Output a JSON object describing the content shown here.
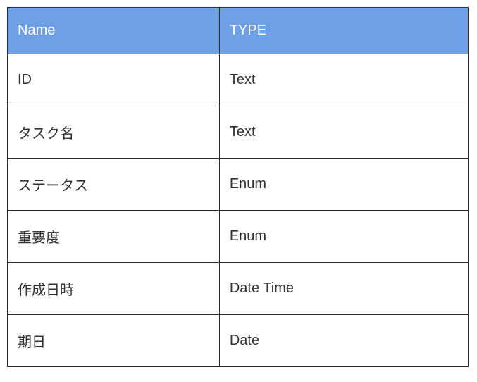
{
  "table": {
    "headers": {
      "name": "Name",
      "type": "TYPE"
    },
    "rows": [
      {
        "name": "ID",
        "type": "Text"
      },
      {
        "name": "タスク名",
        "type": "Text"
      },
      {
        "name": "ステータス",
        "type": "Enum"
      },
      {
        "name": "重要度",
        "type": "Enum"
      },
      {
        "name": "作成日時",
        "type": "Date Time"
      },
      {
        "name": "期日",
        "type": "Date"
      }
    ]
  }
}
